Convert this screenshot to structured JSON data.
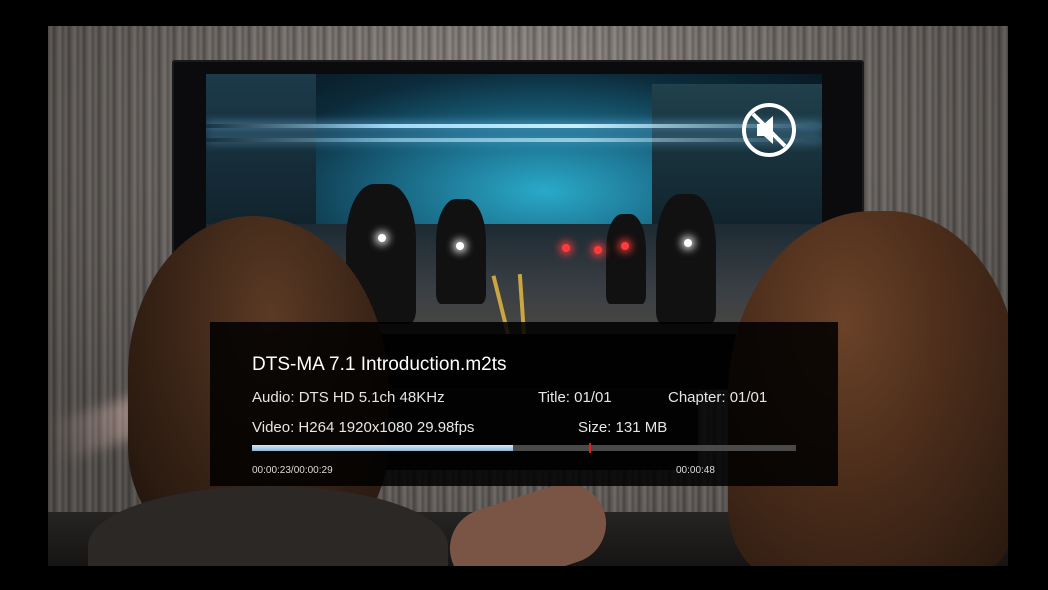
{
  "media_info": {
    "filename": "DTS-MA 7.1 Introduction.m2ts",
    "audio": "Audio: DTS HD 5.1ch 48KHz",
    "title": "Title: 01/01",
    "chapter": "Chapter: 01/01",
    "video": "Video: H264 1920x1080 29.98fps",
    "size": "Size: 131 MB"
  },
  "playback": {
    "elapsed_total": "00:00:23/00:00:29",
    "end_time": "00:00:48",
    "progress_fraction": 0.48,
    "marker_fraction": 0.62
  },
  "status_icons": {
    "mute": "muted-speaker-icon"
  },
  "colors": {
    "panel_bg": "#000000",
    "progress_fill": "#c7dcec",
    "marker": "#dd2222"
  }
}
